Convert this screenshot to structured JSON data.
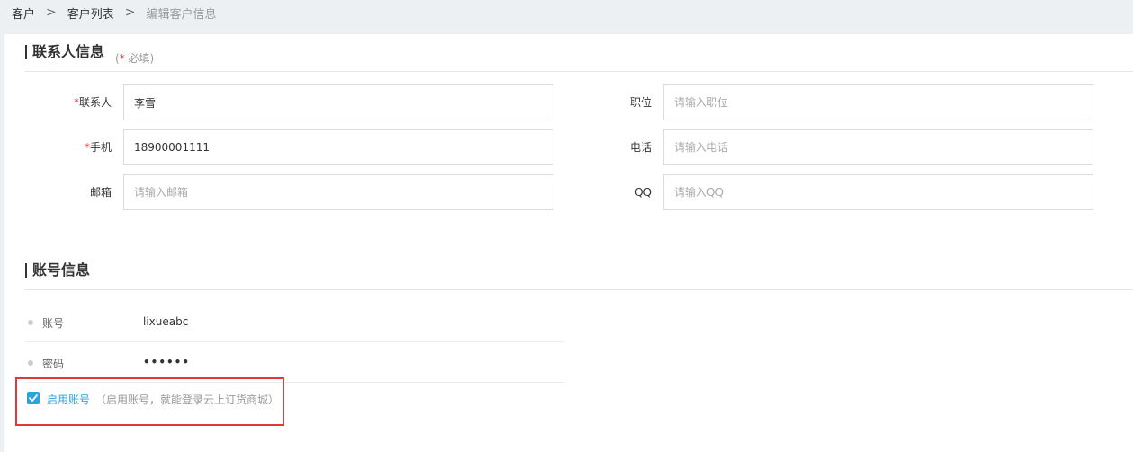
{
  "breadcrumb": {
    "items": [
      "客户",
      "客户列表",
      "编辑客户信息"
    ]
  },
  "contact_section": {
    "title": "联系人信息",
    "required_note_prefix": "(",
    "required_note_star": "*",
    "required_note_text": " 必填)",
    "fields": {
      "contact": {
        "label": "联系人",
        "required": true,
        "value": "李雪",
        "placeholder": ""
      },
      "mobile": {
        "label": "手机",
        "required": true,
        "value": "18900001111",
        "placeholder": ""
      },
      "email": {
        "label": "邮箱",
        "required": false,
        "value": "",
        "placeholder": "请输入邮箱"
      },
      "position": {
        "label": "职位",
        "required": false,
        "value": "",
        "placeholder": "请输入职位"
      },
      "phone": {
        "label": "电话",
        "required": false,
        "value": "",
        "placeholder": "请输入电话"
      },
      "qq": {
        "label": "QQ",
        "required": false,
        "value": "",
        "placeholder": "请输入QQ"
      }
    },
    "star": "*"
  },
  "account_section": {
    "title": "账号信息",
    "account_label": "账号",
    "account_value": "lixueabc",
    "password_label": "密码",
    "password_value": "••••••",
    "enable_label": "启用账号",
    "enable_note": "（启用账号，就能登录云上订货商城）",
    "enable_checked": true
  },
  "colors": {
    "accent": "#2ea2dc",
    "required": "#e4393c",
    "highlight_border": "#e0393c"
  }
}
